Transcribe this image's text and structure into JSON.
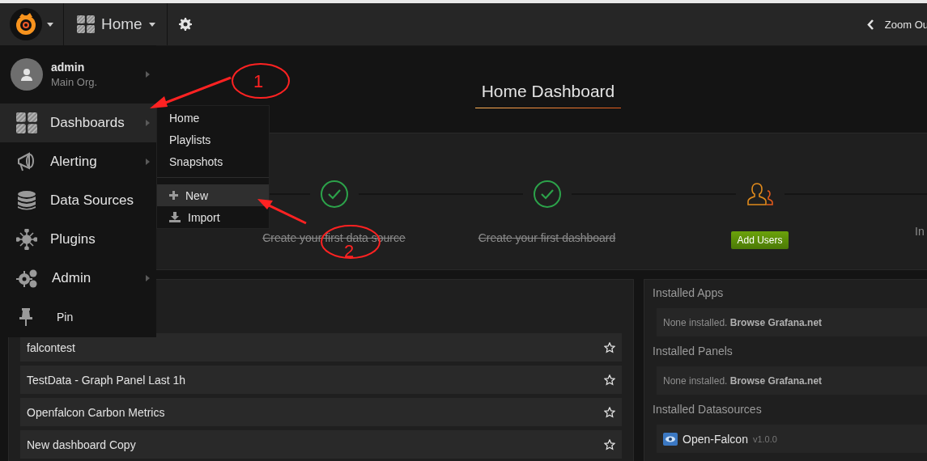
{
  "navbar": {
    "dashboard_title": "Home",
    "zoom_out": "Zoom Ou"
  },
  "title": "Home Dashboard",
  "getting_started": {
    "steps": [
      {
        "kind": "done",
        "label": "Create your first data source"
      },
      {
        "kind": "done",
        "label": "Create your first dashboard"
      },
      {
        "kind": "action",
        "button": "Add Users"
      },
      {
        "kind": "pending",
        "label": "In"
      }
    ]
  },
  "recent_dashboards": [
    {
      "title": "falcontest",
      "starred": false
    },
    {
      "title": "TestData - Graph Panel Last 1h",
      "starred": false
    },
    {
      "title": "Openfalcon Carbon Metrics",
      "starred": false
    },
    {
      "title": "New dashboard Copy",
      "starred": false
    }
  ],
  "installed": [
    {
      "heading": "Installed Apps",
      "note": "None installed. **Browse Grafana.net**"
    },
    {
      "heading": "Installed Panels",
      "note": "None installed. **Browse Grafana.net**"
    },
    {
      "heading": "Installed Datasources",
      "items": [
        {
          "name": "Open-Falcon",
          "version": "v1.0.0"
        }
      ]
    }
  ],
  "side_menu": {
    "profile": {
      "name": "admin",
      "org": "Main Org.",
      "has_submenu": true
    },
    "items": [
      {
        "kind": "dashboards",
        "label": "Dashboards",
        "selected": true,
        "has_submenu": true
      },
      {
        "kind": "alerting",
        "label": "Alerting",
        "selected": false,
        "has_submenu": true
      },
      {
        "kind": "datasources",
        "label": "Data Sources",
        "selected": false,
        "has_submenu": false
      },
      {
        "kind": "plugins",
        "label": "Plugins",
        "selected": false,
        "has_submenu": false
      },
      {
        "kind": "admin",
        "label": "Admin",
        "selected": false,
        "has_submenu": true
      },
      {
        "kind": "pin",
        "label": "Pin",
        "selected": false,
        "has_submenu": false
      }
    ]
  },
  "submenu": {
    "links": [
      {
        "label": "Home"
      },
      {
        "label": "Playlists"
      },
      {
        "label": "Snapshots"
      }
    ],
    "actions": [
      {
        "kind": "new",
        "label": "New",
        "selected": true
      },
      {
        "kind": "import",
        "label": "Import",
        "selected": false
      }
    ]
  },
  "annotations": [
    {
      "label": "1"
    },
    {
      "label": "2"
    }
  ]
}
